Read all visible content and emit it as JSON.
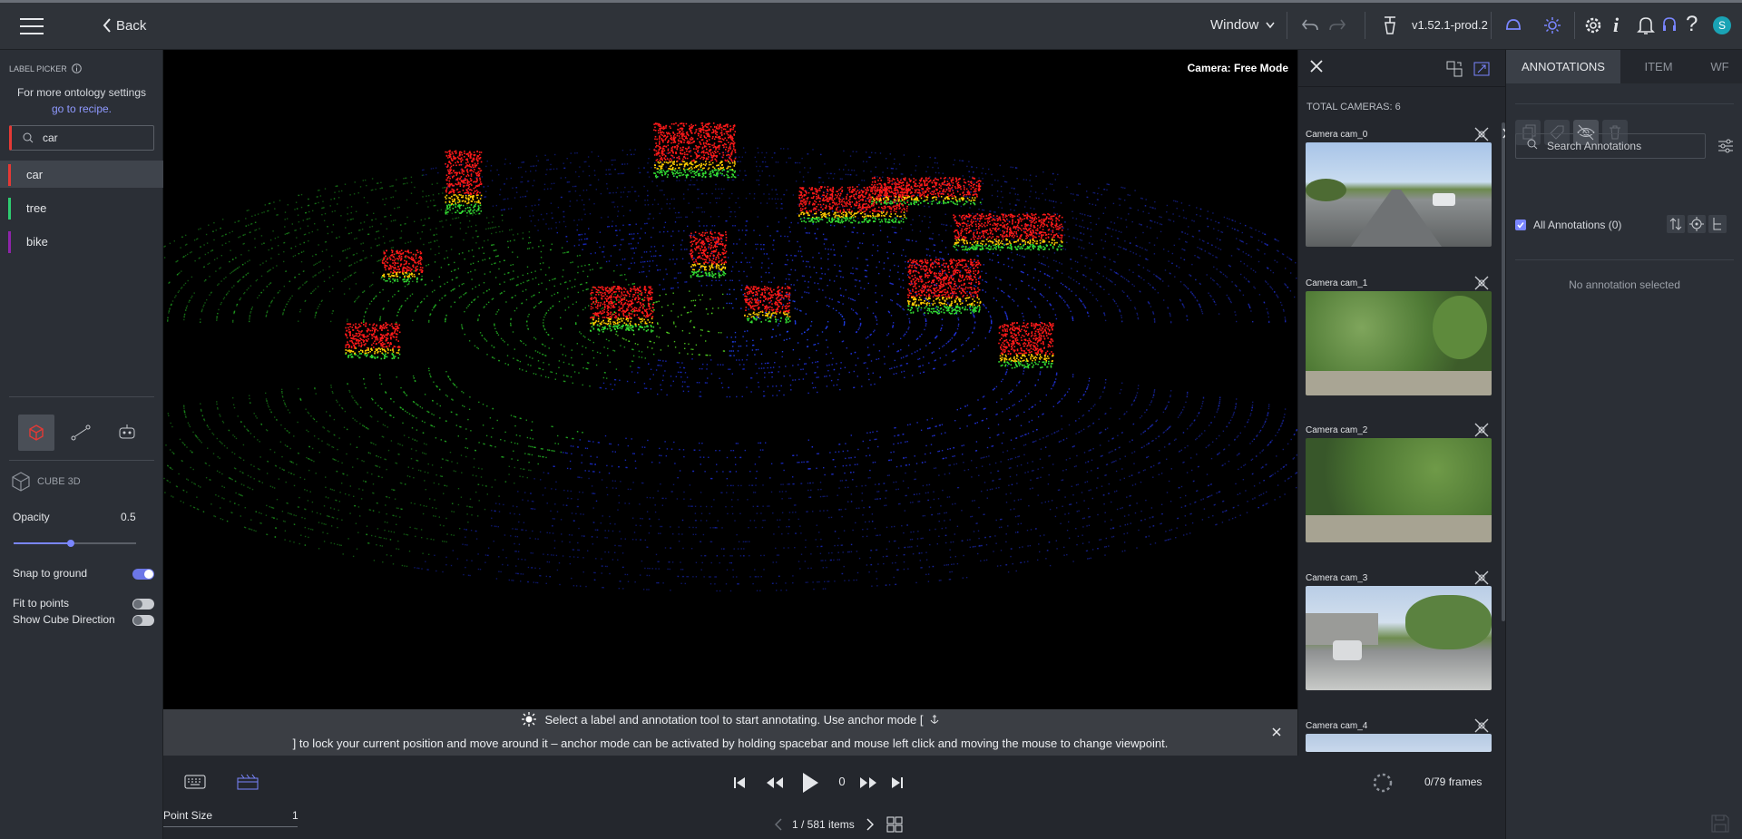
{
  "topbar": {
    "back_label": "Back",
    "window_label": "Window",
    "version": "v1.52.1-prod.2",
    "avatar_letter": "S"
  },
  "left": {
    "label_picker_title": "LABEL PICKER",
    "ontology_text": "For more ontology settings",
    "recipe_link": "go to recipe.",
    "search_value": "car",
    "labels": [
      {
        "name": "car",
        "color": "#e53935"
      },
      {
        "name": "tree",
        "color": "#2ecc71"
      },
      {
        "name": "bike",
        "color": "#8e24aa"
      }
    ],
    "tool_name": "CUBE 3D",
    "opacity_label": "Opacity",
    "opacity_value": "0.5",
    "snap_label": "Snap to ground",
    "fit_label": "Fit to points",
    "direction_label": "Show Cube Direction",
    "toggles": {
      "snap": true,
      "fit": false,
      "direction": false
    }
  },
  "viewer": {
    "camera_mode": "Camera: Free Mode",
    "hint_line1": "Select a label and annotation tool to start annotating. Use anchor mode [",
    "hint_line2": "] to lock your current position and move around it – anchor mode can be activated by holding spacebar and mouse left click and moving the mouse to change viewpoint."
  },
  "cameras": {
    "total_label": "TOTAL CAMERAS: 6",
    "items": [
      {
        "title": "Camera cam_0"
      },
      {
        "title": "Camera cam_1"
      },
      {
        "title": "Camera cam_2"
      },
      {
        "title": "Camera cam_3"
      },
      {
        "title": "Camera cam_4"
      }
    ]
  },
  "right": {
    "tabs": [
      "ANNOTATIONS",
      "ITEM",
      "WF"
    ],
    "search_placeholder": "Search Annotations",
    "all_annotations": "All Annotations (0)",
    "empty_text": "No annotation selected"
  },
  "timeline": {
    "frame": "0",
    "frames_label": "0/79 frames",
    "point_size_label": "Point Size",
    "point_size_value": "1",
    "items_label": "1 / 581 items"
  },
  "colors": {
    "accent": "#7a86ff",
    "teal": "#1aa3b5"
  }
}
